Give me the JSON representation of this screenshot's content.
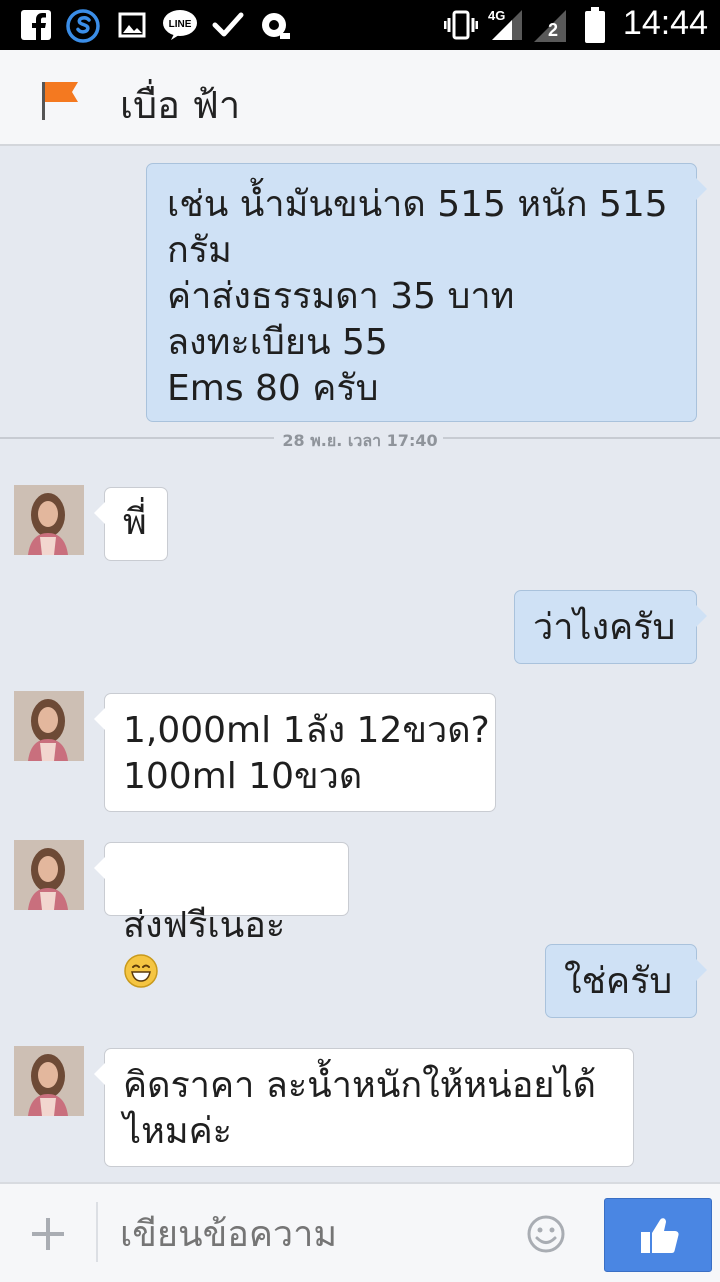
{
  "status_bar": {
    "time": "14:44",
    "network": "4G",
    "icons": [
      "facebook-icon",
      "s-app-icon",
      "gallery-icon",
      "line-icon",
      "check-icon",
      "camera-icon",
      "vibrate-icon",
      "signal-icon",
      "sim-icon",
      "battery-icon"
    ]
  },
  "header": {
    "title": "เบื่อ ฟ้า",
    "icon": "flag-icon",
    "accent": "#f47920"
  },
  "conversation": {
    "messages": [
      {
        "dir": "out",
        "text": "เช่น น้ำมันขน่าด 515 หนัก 515\nกรัม\nค่าส่งธรรมดา 35 บาท\nลงทะเบียน 55\nEms 80 ครับ"
      },
      {
        "dir": "in",
        "text": "พี่"
      },
      {
        "dir": "out",
        "text": "ว่าไงครับ"
      },
      {
        "dir": "in",
        "text": "1,000ml 1ลัง 12ขวด?\n100ml  10ขวด"
      },
      {
        "dir": "in",
        "text": "ส่งฟรีเนอะ",
        "emoji": "grinning-face-icon"
      },
      {
        "dir": "out",
        "text": "ใช่ครับ"
      },
      {
        "dir": "in",
        "text": "คิดราคา ละน้ำหนักให้หน่อยได้\nไหมค่ะ"
      }
    ],
    "divider_timestamp": "28 พ.ย. เวลา 17:40"
  },
  "composer": {
    "placeholder": "เขียนข้อความ",
    "icons": [
      "plus-icon",
      "emoji-icon",
      "thumbs-up-icon"
    ]
  },
  "colors": {
    "outgoing_bubble": "#cfe1f5",
    "incoming_bubble": "#ffffff",
    "send_button": "#4a86e3",
    "background": "#e5e9f0"
  }
}
